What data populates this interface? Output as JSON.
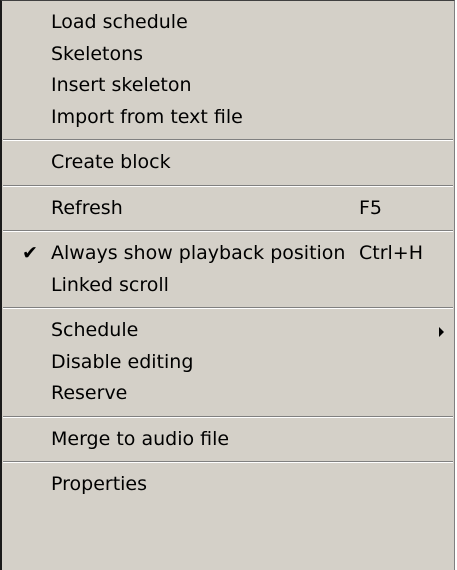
{
  "menu": {
    "groups": [
      {
        "items": [
          {
            "label": "Load schedule"
          },
          {
            "label": "Skeletons"
          },
          {
            "label": "Insert skeleton"
          },
          {
            "label": "Import from text file"
          }
        ]
      },
      {
        "items": [
          {
            "label": "Create block"
          }
        ]
      },
      {
        "items": [
          {
            "label": "Refresh",
            "shortcut": "F5"
          }
        ]
      },
      {
        "items": [
          {
            "label": "Always show playback position",
            "shortcut": "Ctrl+H",
            "check": "✔"
          },
          {
            "label": "Linked scroll"
          }
        ]
      },
      {
        "items": [
          {
            "label": "Schedule"
          },
          {
            "label": "Disable editing"
          },
          {
            "label": "Reserve"
          }
        ]
      },
      {
        "items": [
          {
            "label": "Merge to audio file"
          }
        ]
      },
      {
        "items": [
          {
            "label": "Properties"
          }
        ]
      }
    ]
  }
}
